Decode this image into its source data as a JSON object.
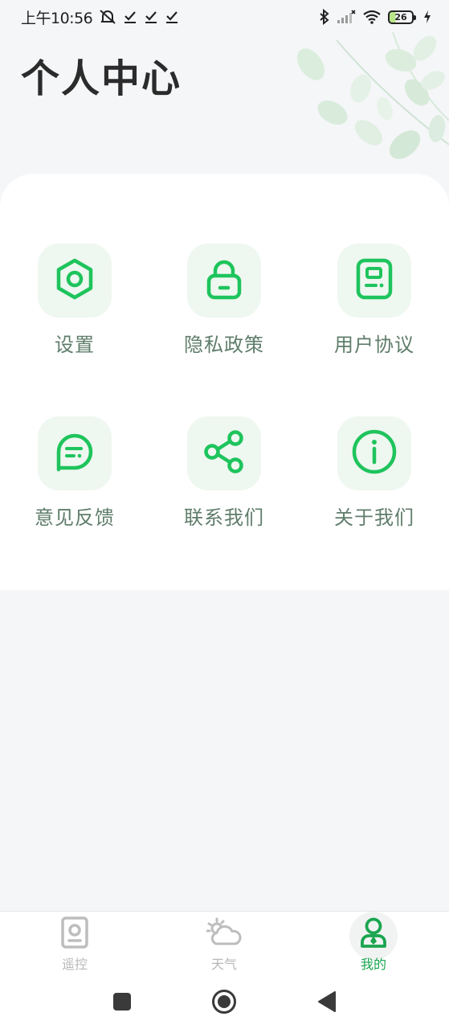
{
  "status_bar": {
    "time": "上午10:56",
    "battery_level": "26",
    "icons": [
      "mute-bell-icon",
      "check-icon",
      "check-icon",
      "check-icon",
      "bluetooth-icon",
      "signal-icon",
      "wifi-icon",
      "battery-icon",
      "charging-icon"
    ]
  },
  "header": {
    "title": "个人中心"
  },
  "menu": {
    "items": [
      {
        "label": "设置",
        "icon": "settings-hex-icon"
      },
      {
        "label": "隐私政策",
        "icon": "lock-icon"
      },
      {
        "label": "用户协议",
        "icon": "document-icon"
      },
      {
        "label": "意见反馈",
        "icon": "chat-bubble-icon"
      },
      {
        "label": "联系我们",
        "icon": "share-icon"
      },
      {
        "label": "关于我们",
        "icon": "info-icon"
      }
    ]
  },
  "bottom_nav": {
    "items": [
      {
        "label": "遥控",
        "icon": "remote-icon",
        "active": false
      },
      {
        "label": "天气",
        "icon": "weather-icon",
        "active": false
      },
      {
        "label": "我的",
        "icon": "user-icon",
        "active": true
      }
    ]
  },
  "colors": {
    "accent": "#1ec45c",
    "label": "#5f7d6b",
    "tile_bg": "#eef7f0",
    "inactive_nav": "#b8b8b8",
    "page_bg": "#f5f6f8"
  }
}
